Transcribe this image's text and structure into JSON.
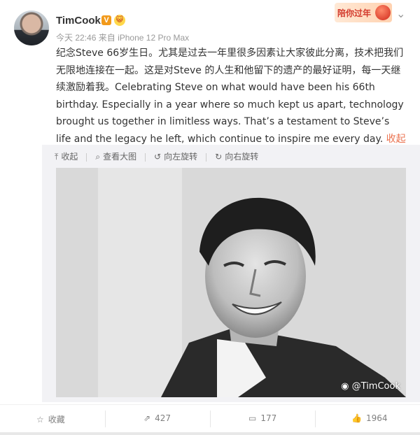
{
  "header": {
    "username": "TimCook",
    "verified_badge": "V",
    "fan_badge": "😺",
    "time": "今天 22:46",
    "source_prefix": "来自",
    "device": "iPhone 12 Pro Max",
    "banner_text": "陪你过年",
    "menu_icon": "chevron-down-icon"
  },
  "post": {
    "text": "纪念Steve 66岁生日。尤其是过去一年里很多因素让大家彼此分离，技术把我们无限地连接在一起。这是对Steve 的人生和他留下的遗产的最好证明，每一天继续激励着我。Celebrating Steve on what would have been his 66th birthday. Especially in a year where so much kept us apart, technology brought us together in limitless ways. That’s a testament to Steve’s life and the legacy he left, which continue to inspire me every day.",
    "collapse_label": "收起全文",
    "collapse_icon": "^"
  },
  "media": {
    "tools": [
      {
        "icon": "⤒",
        "label": "收起"
      },
      {
        "icon": "⌕",
        "label": "查看大图"
      },
      {
        "icon": "↺",
        "label": "向左旋转"
      },
      {
        "icon": "↻",
        "label": "向右旋转"
      }
    ],
    "watermark": "@TimCook"
  },
  "footer": {
    "favorite_label": "收藏",
    "repost_count": "427",
    "comment_count": "177",
    "like_count": "1964"
  },
  "colors": {
    "accent": "#eb7350",
    "muted": "#999999",
    "panel": "#f2f2f5"
  }
}
